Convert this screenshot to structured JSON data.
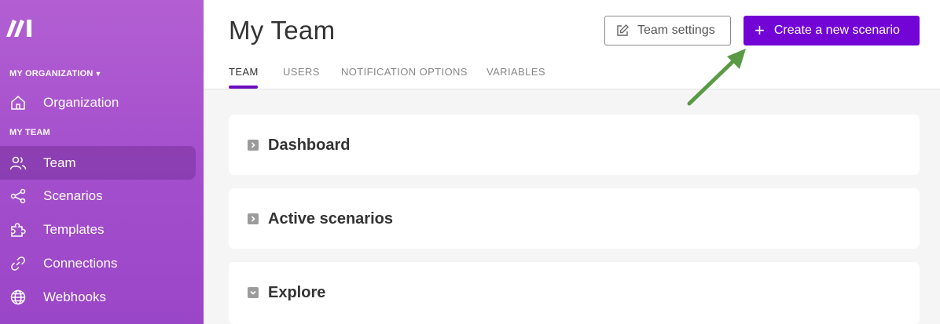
{
  "sidebar": {
    "logo_icon": "make-logo-icon",
    "org_section_label": "MY ORGANIZATION",
    "team_section_label": "MY TEAM",
    "items": [
      {
        "label": "Organization",
        "icon": "home-icon",
        "active": false
      },
      {
        "label": "Team",
        "icon": "users-icon",
        "active": true
      },
      {
        "label": "Scenarios",
        "icon": "share-nodes-icon",
        "active": false
      },
      {
        "label": "Templates",
        "icon": "puzzle-icon",
        "active": false
      },
      {
        "label": "Connections",
        "icon": "link-icon",
        "active": false
      },
      {
        "label": "Webhooks",
        "icon": "globe-icon",
        "active": false
      }
    ]
  },
  "header": {
    "title": "My Team",
    "team_settings_label": "Team settings",
    "create_scenario_label": "Create a new scenario",
    "tabs": [
      {
        "label": "TEAM",
        "active": true
      },
      {
        "label": "USERS",
        "active": false
      },
      {
        "label": "NOTIFICATION OPTIONS",
        "active": false
      },
      {
        "label": "VARIABLES",
        "active": false
      }
    ]
  },
  "main": {
    "sections": [
      {
        "title": "Dashboard",
        "expanded": false
      },
      {
        "title": "Active scenarios",
        "expanded": false
      },
      {
        "title": "Explore",
        "expanded": true
      }
    ]
  },
  "colors": {
    "sidebar_gradient_top": "#b35fd3",
    "primary_button": "#7205d6",
    "tab_underline": "#6a0dbd",
    "annotation_arrow": "#5a9a45"
  }
}
